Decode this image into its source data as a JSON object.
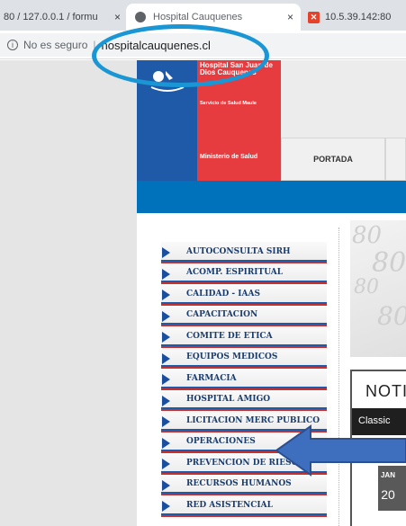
{
  "browser": {
    "tabs": [
      {
        "label": "80 / 127.0.0.1 / formu",
        "close": "×"
      },
      {
        "label": "Hospital Cauquenes",
        "close": "×"
      },
      {
        "label": "10.5.39.142:80",
        "icon": "x-icon"
      }
    ],
    "address": {
      "security_label": "No es seguro",
      "separator": "|",
      "url": "hospitalcauquenes.cl"
    }
  },
  "header": {
    "title": "Hospital San Juan de Dios Cauquenes",
    "subtitle": "Servicio de Salud Maule",
    "ministry": "Ministerio de Salud",
    "nav_tab": "PORTADA"
  },
  "sidebar_menu": [
    "AUTOCONSULTA SIRH",
    "ACOMP. ESPIRITUAL",
    "CALIDAD - IAAS",
    "CAPACITACION",
    "COMITE DE ETICA",
    "EQUIPOS MEDICOS",
    "FARMACIA",
    "HOSPITAL AMIGO",
    "LICITACION MERC PUBLICO",
    "OPERACIONES",
    "PREVENCION DE RIESGOS",
    "RECURSOS HUMANOS",
    "RED ASISTENCIAL"
  ],
  "news": {
    "heading": "NOTI",
    "view_label": "Classic",
    "date_month": "JAN",
    "date_day": "20"
  },
  "colors": {
    "gov_blue": "#1e5aa8",
    "gov_red": "#e63b3f",
    "band_blue": "#0072bc",
    "annotation_blue": "#1a96d5",
    "arrow_blue": "#3e6fbf"
  }
}
